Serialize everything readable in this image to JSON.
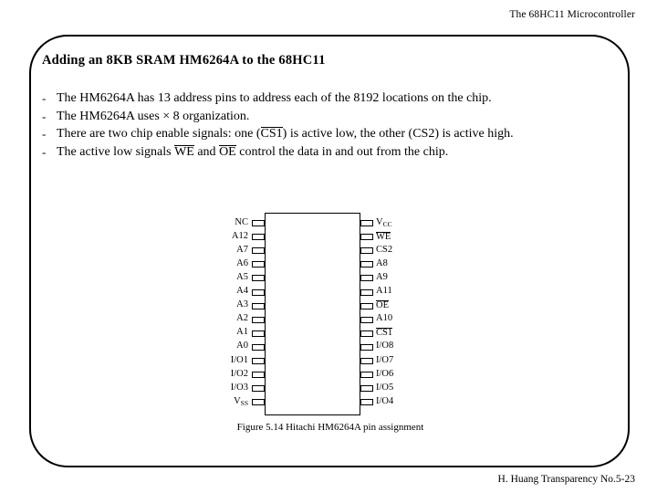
{
  "header": {
    "title": "The 68HC11 Microcontroller"
  },
  "slide": {
    "title": "Adding an 8KB SRAM HM6264A to the 68HC11",
    "bullet_marker": "-",
    "bullets": [
      {
        "id": "bullet-address-pins",
        "segments": [
          {
            "text": "The HM6264A has 13 address pins to address each of the 8192 locations on the chip.",
            "overline": false
          }
        ]
      },
      {
        "id": "bullet-organization",
        "segments": [
          {
            "text": "The HM6264A uses × 8 organization.",
            "overline": false
          }
        ]
      },
      {
        "id": "bullet-chip-enable",
        "segments": [
          {
            "text": "There are two chip enable signals: one (",
            "overline": false
          },
          {
            "text": "CS1",
            "overline": true
          },
          {
            "text": ") is active low, the other (CS2) is active high.",
            "overline": false
          }
        ]
      },
      {
        "id": "bullet-we-oe",
        "segments": [
          {
            "text": "The active low signals ",
            "overline": false
          },
          {
            "text": "WE",
            "overline": true
          },
          {
            "text": " and ",
            "overline": false
          },
          {
            "text": "OE",
            "overline": true
          },
          {
            "text": " control the data in and out from the chip.",
            "overline": false
          }
        ]
      }
    ]
  },
  "figure": {
    "caption": "Figure 5.14 Hitachi HM6264A pin assignment",
    "left_pins": [
      {
        "label": "NC",
        "overline": false,
        "sub": ""
      },
      {
        "label": "A12",
        "overline": false,
        "sub": ""
      },
      {
        "label": "A7",
        "overline": false,
        "sub": ""
      },
      {
        "label": "A6",
        "overline": false,
        "sub": ""
      },
      {
        "label": "A5",
        "overline": false,
        "sub": ""
      },
      {
        "label": "A4",
        "overline": false,
        "sub": ""
      },
      {
        "label": "A3",
        "overline": false,
        "sub": ""
      },
      {
        "label": "A2",
        "overline": false,
        "sub": ""
      },
      {
        "label": "A1",
        "overline": false,
        "sub": ""
      },
      {
        "label": "A0",
        "overline": false,
        "sub": ""
      },
      {
        "label": "I/O1",
        "overline": false,
        "sub": ""
      },
      {
        "label": "I/O2",
        "overline": false,
        "sub": ""
      },
      {
        "label": "I/O3",
        "overline": false,
        "sub": ""
      },
      {
        "label": "V",
        "overline": false,
        "sub": "SS"
      }
    ],
    "right_pins": [
      {
        "label": "V",
        "overline": false,
        "sub": "CC"
      },
      {
        "label": "WE",
        "overline": true,
        "sub": ""
      },
      {
        "label": "CS2",
        "overline": false,
        "sub": ""
      },
      {
        "label": "A8",
        "overline": false,
        "sub": ""
      },
      {
        "label": "A9",
        "overline": false,
        "sub": ""
      },
      {
        "label": "A11",
        "overline": false,
        "sub": ""
      },
      {
        "label": "OE",
        "overline": true,
        "sub": ""
      },
      {
        "label": "A10",
        "overline": false,
        "sub": ""
      },
      {
        "label": "CS1",
        "overline": true,
        "sub": ""
      },
      {
        "label": "I/O8",
        "overline": false,
        "sub": ""
      },
      {
        "label": "I/O7",
        "overline": false,
        "sub": ""
      },
      {
        "label": "I/O6",
        "overline": false,
        "sub": ""
      },
      {
        "label": "I/O5",
        "overline": false,
        "sub": ""
      },
      {
        "label": "I/O4",
        "overline": false,
        "sub": ""
      }
    ]
  },
  "footer": {
    "text": "H. Huang Transparency No.5-23"
  },
  "colors": {
    "ink": "#000000",
    "page": "#ffffff"
  }
}
